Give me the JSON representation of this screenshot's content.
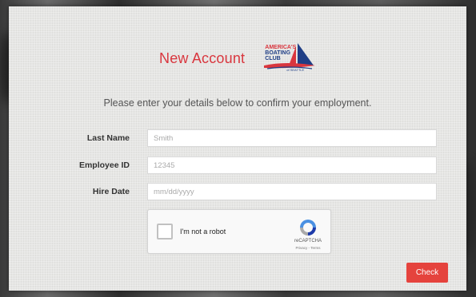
{
  "header": {
    "title": "New Account",
    "logo": {
      "line1": "AMERICA'S",
      "line2": "BOATING",
      "line3": "CLUB",
      "line4": "of SEATTLE"
    }
  },
  "intro_text": "Please enter your details below to confirm your employment.",
  "form": {
    "fields": [
      {
        "label": "Last Name",
        "placeholder": "Smith"
      },
      {
        "label": "Employee ID",
        "placeholder": "12345"
      },
      {
        "label": "Hire Date",
        "placeholder": "mm/dd/yyyy"
      }
    ]
  },
  "captcha": {
    "label": "I'm not a robot",
    "brand": "reCAPTCHA",
    "links": "Privacy - Terms"
  },
  "actions": {
    "check_label": "Check"
  },
  "colors": {
    "accent_red": "#d9363e",
    "button_red": "#e5433d",
    "logo_blue": "#1f3e86"
  }
}
